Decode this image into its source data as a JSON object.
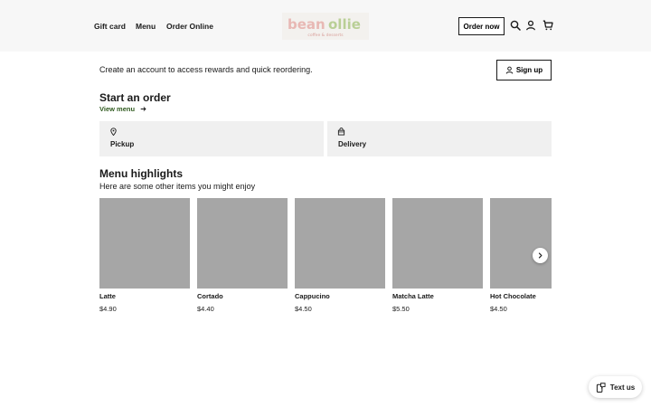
{
  "header": {
    "nav": [
      "Gift card",
      "Menu",
      "Order Online"
    ],
    "logo_text": "bean ollie",
    "logo_subtext": "coffee & desserts",
    "order_now_label": "Order now"
  },
  "account": {
    "prompt": "Create an account to access rewards and quick reordering.",
    "signup_label": "Sign up"
  },
  "order": {
    "title": "Start an order",
    "view_menu_label": "View menu",
    "options": [
      "Pickup",
      "Delivery"
    ]
  },
  "highlights": {
    "title": "Menu highlights",
    "subtitle": "Here are some other items you might enjoy",
    "items": [
      {
        "name": "Latte",
        "price": "$4.90"
      },
      {
        "name": "Cortado",
        "price": "$4.40"
      },
      {
        "name": "Cappucino",
        "price": "$4.50"
      },
      {
        "name": "Matcha Latte",
        "price": "$5.50"
      },
      {
        "name": "Hot Chocolate",
        "price": "$4.50"
      }
    ]
  },
  "chat": {
    "label": "Text us"
  },
  "colors": {
    "header_bg": "#f7f7f7",
    "accent_green": "#2f5a1e",
    "logo_pink": "#e8b8b4",
    "logo_green": "#b9cf96",
    "placeholder": "#a6a6a6"
  }
}
